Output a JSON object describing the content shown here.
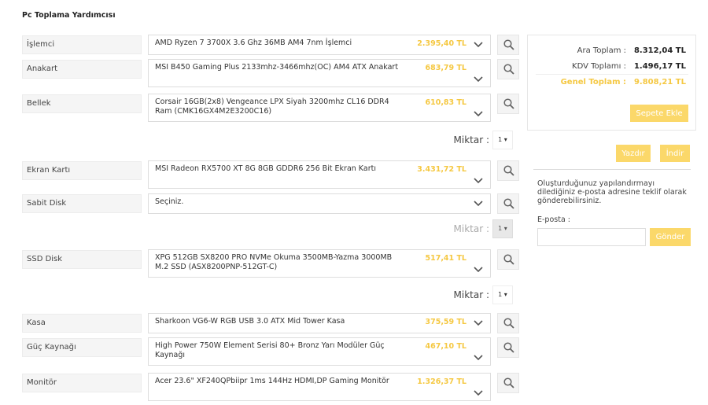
{
  "title": "Pc Toplama Yardımcısı",
  "components": [
    {
      "label": "İşlemci",
      "product": "AMD Ryzen 7 3700X 3.6 Ghz 36MB AM4 7nm İşlemci",
      "price": "2.395,40 TL"
    },
    {
      "label": "Anakart",
      "product": "MSI B450 Gaming Plus 2133mhz-3466mhz(OC) AM4 ATX Anakart",
      "price": "683,79 TL"
    },
    {
      "label": "Bellek",
      "product": "Corsair 16GB(2x8) Vengeance LPX Siyah 3200mhz CL16 DDR4 Ram (CMK16GX4M2E3200C16)",
      "price": "610,83 TL"
    },
    {
      "label": "Ekran Kartı",
      "product": "MSI Radeon RX5700 XT 8G 8GB GDDR6 256 Bit Ekran Kartı",
      "price": "3.431,72 TL"
    },
    {
      "label": "Sabit Disk",
      "product": "Seçiniz.",
      "price": ""
    },
    {
      "label": "SSD Disk",
      "product": "XPG 512GB SX8200 PRO NVMe Okuma 3500MB-Yazma 3000MB M.2 SSD (ASX8200PNP-512GT-C)",
      "price": "517,41 TL"
    },
    {
      "label": "Kasa",
      "product": "Sharkoon VG6-W RGB USB 3.0 ATX Mid Tower Kasa",
      "price": "375,59 TL"
    },
    {
      "label": "Güç Kaynağı",
      "product": "High Power 750W Element Serisi 80+ Bronz Yarı Modüler Güç Kaynağı",
      "price": "467,10 TL"
    },
    {
      "label": "Monitör",
      "product": "Acer 23.6\" XF240QPbiipr 1ms 144Hz HDMI,DP Gaming Monitör",
      "price": "1.326,37 TL"
    }
  ],
  "quantity": {
    "label": "Miktar :",
    "memory": "1",
    "disk": "1",
    "ssd": "1"
  },
  "summary": {
    "subtotal_label": "Ara Toplam :",
    "subtotal": "8.312,04 TL",
    "vat_label": "KDV Toplamı :",
    "vat": "1.496,17 TL",
    "total_label": "Genel Toplam :",
    "total": "9.808,21 TL",
    "add_to_cart": "Sepete Ekle"
  },
  "actions": {
    "print": "Yazdır",
    "download": "İndir"
  },
  "email": {
    "info": "Oluşturduğunuz yapılandırmayı dilediğiniz e-posta adresine teklif olarak gönderebilirsiniz.",
    "label": "E-posta :",
    "value": "",
    "send": "Gönder"
  },
  "colors": {
    "accent": "#fbd86a",
    "price": "#f5c842"
  }
}
